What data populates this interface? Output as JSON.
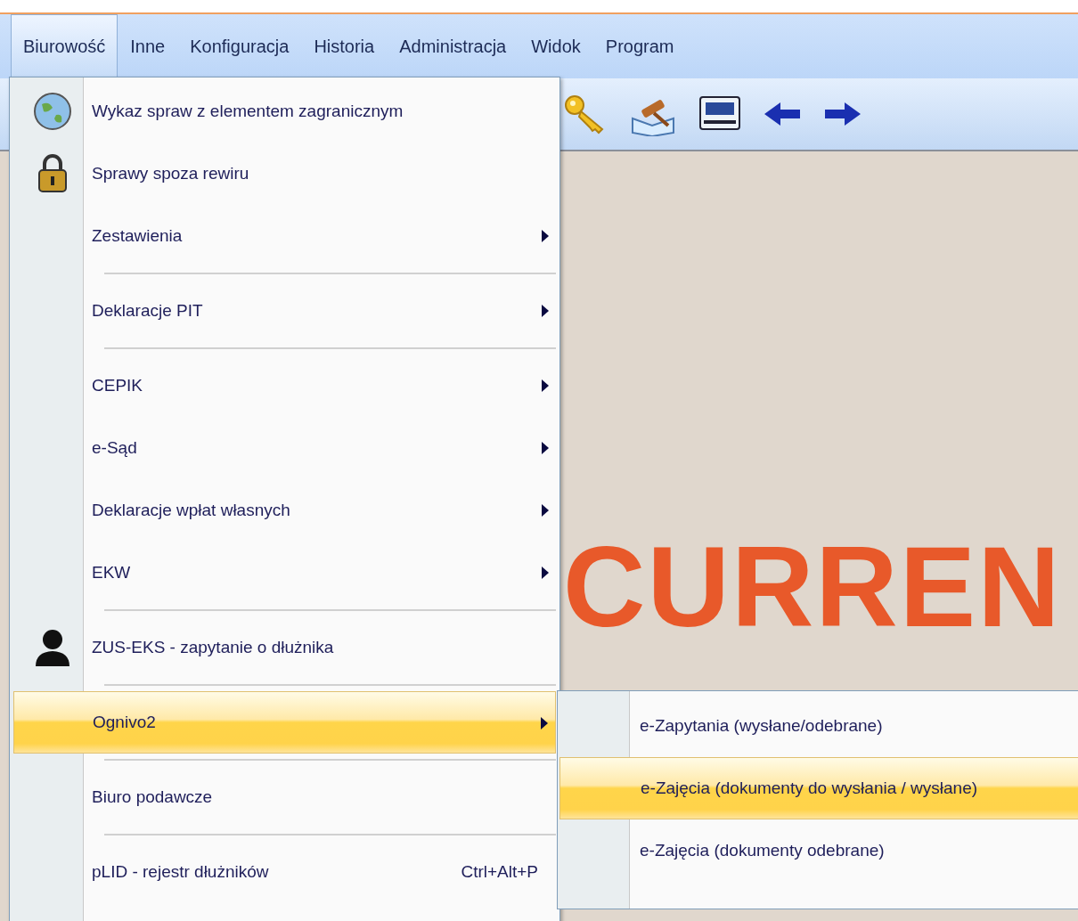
{
  "menu_bar": {
    "items": [
      {
        "label": "Biurowość",
        "selected": true
      },
      {
        "label": "Inne",
        "selected": false
      },
      {
        "label": "Konfiguracja",
        "selected": false
      },
      {
        "label": "Historia",
        "selected": false
      },
      {
        "label": "Administracja",
        "selected": false
      },
      {
        "label": "Widok",
        "selected": false
      },
      {
        "label": "Program",
        "selected": false
      }
    ]
  },
  "workspace": {
    "background_text": "CURREN"
  },
  "dropdown": {
    "items": [
      {
        "kind": "item",
        "label": "Wykaz spraw z elementem zagranicznym",
        "submenu": false,
        "selected": false
      },
      {
        "kind": "item",
        "label": "Sprawy spoza rewiru",
        "submenu": false,
        "selected": false
      },
      {
        "kind": "item",
        "label": "Zestawienia",
        "submenu": true,
        "selected": false
      },
      {
        "kind": "separator"
      },
      {
        "kind": "item",
        "label": "Deklaracje PIT",
        "submenu": true,
        "selected": false
      },
      {
        "kind": "separator"
      },
      {
        "kind": "item",
        "label": "CEPIK",
        "submenu": true,
        "selected": false
      },
      {
        "kind": "item",
        "label": "e-Sąd",
        "submenu": true,
        "selected": false
      },
      {
        "kind": "item",
        "label": "Deklaracje wpłat własnych",
        "submenu": true,
        "selected": false
      },
      {
        "kind": "item",
        "label": "EKW",
        "submenu": true,
        "selected": false
      },
      {
        "kind": "separator"
      },
      {
        "kind": "item",
        "label": "ZUS-EKS - zapytanie o dłużnika",
        "submenu": false,
        "selected": false
      },
      {
        "kind": "separator"
      },
      {
        "kind": "item",
        "label": "Ognivo2",
        "submenu": true,
        "selected": true
      },
      {
        "kind": "separator"
      },
      {
        "kind": "item",
        "label": "Biuro podawcze",
        "submenu": false,
        "selected": false
      },
      {
        "kind": "separator"
      },
      {
        "kind": "item",
        "label": "pLID - rejestr dłużników",
        "submenu": false,
        "selected": false,
        "shortcut": "Ctrl+Alt+P"
      }
    ]
  },
  "submenu": {
    "items": [
      {
        "label": "e-Zapytania (wysłane/odebrane)",
        "selected": false
      },
      {
        "label": "e-Zajęcia (dokumenty do wysłania / wysłane)",
        "selected": true
      },
      {
        "label": "e-Zajęcia (dokumenty odebrane)",
        "selected": false
      }
    ]
  }
}
